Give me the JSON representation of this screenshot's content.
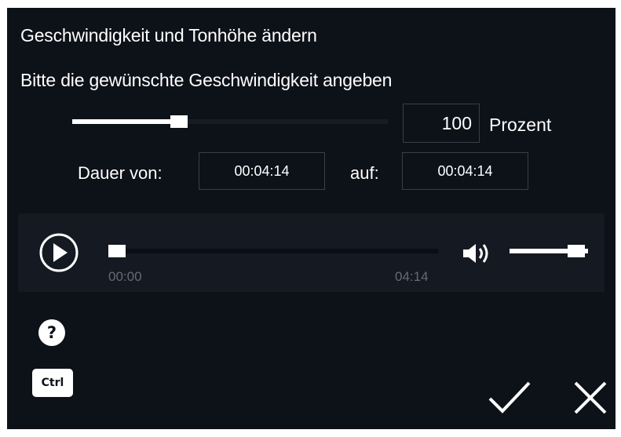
{
  "dialog": {
    "title": "Geschwindigkeit und Tonhöhe ändern",
    "prompt": "Bitte die gewünschte Geschwindigkeit angeben"
  },
  "speed": {
    "value_fraction": 0.33,
    "percent_value": "100",
    "percent_unit": "Prozent"
  },
  "duration": {
    "from_label": "Dauer von:",
    "from_value": "00:04:14",
    "to_label": "auf:",
    "to_value": "00:04:14"
  },
  "player": {
    "play_icon": "play-circle-icon",
    "position_fraction": 0.0,
    "time_start": "00:00",
    "time_end": "04:14",
    "volume_icon": "speaker-icon",
    "volume_fraction": 0.95
  },
  "footer": {
    "help_label": "?",
    "ctrl_label": "Ctrl",
    "confirm_icon": "checkmark-icon",
    "cancel_icon": "close-icon"
  },
  "colors": {
    "background": "#0d1118",
    "player_background": "#141922",
    "foreground": "#ffffff",
    "muted_text": "#666b73"
  }
}
